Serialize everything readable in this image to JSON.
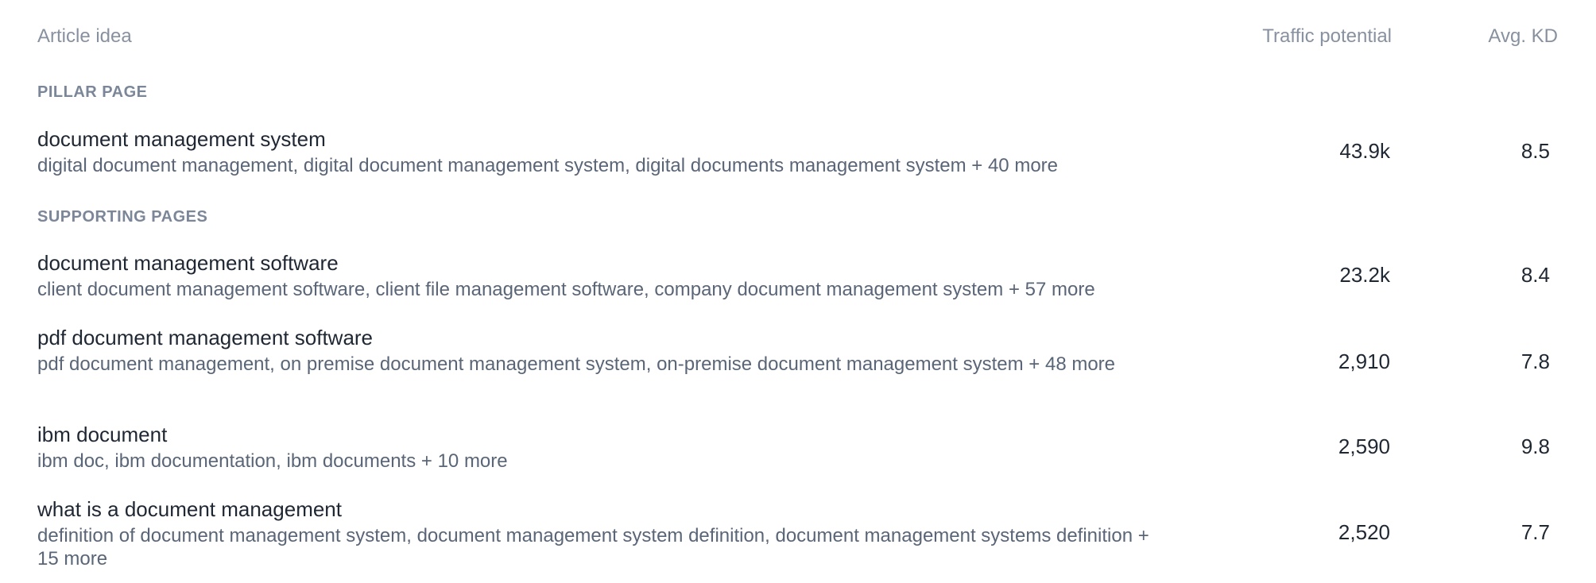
{
  "table": {
    "headers": {
      "article_idea": "Article idea",
      "traffic_potential": "Traffic potential",
      "avg_kd": "Avg. KD"
    },
    "pillar_section": {
      "label": "PILLAR PAGE",
      "rows": [
        {
          "title": "document management system",
          "keywords": "digital document management, digital document management system, digital documents management system + 40 more",
          "traffic": "43.9k",
          "kd": "8.5"
        }
      ]
    },
    "supporting_section": {
      "label": "SUPPORTING PAGES",
      "rows": [
        {
          "title": "document management software",
          "keywords": "client document management software, client file management software, company document management system + 57 more",
          "traffic": "23.2k",
          "kd": "8.4"
        },
        {
          "title": "pdf document management software",
          "keywords": "pdf document management, on premise document management system, on-premise document management system + 48 more",
          "traffic": "2,910",
          "kd": "7.8"
        },
        {
          "title": "ibm document",
          "keywords": "ibm doc, ibm documentation, ibm documents + 10 more",
          "traffic": "2,590",
          "kd": "9.8"
        },
        {
          "title": "what is a document management",
          "keywords": "definition of document management system, document management system definition, document management systems definition + 15 more",
          "traffic": "2,520",
          "kd": "7.7"
        }
      ]
    }
  }
}
